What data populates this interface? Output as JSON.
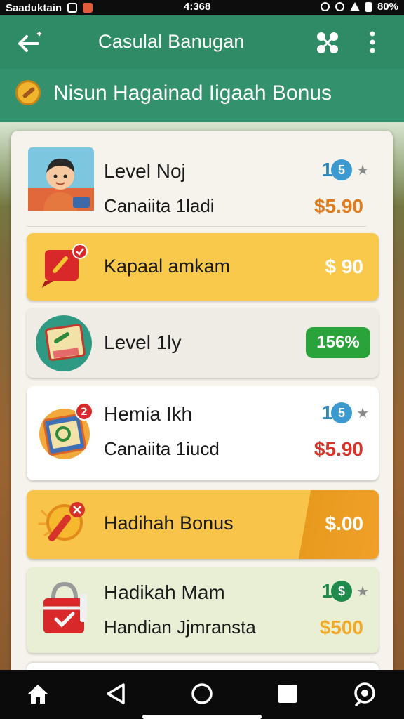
{
  "status_bar": {
    "carrier": "Saaduktain",
    "time": "4:368",
    "battery": "80%"
  },
  "app_bar": {
    "title": "Casulal Banugan",
    "icons": [
      "back-arrow-icon",
      "share-icon",
      "more-vert-icon"
    ]
  },
  "banner": {
    "text": "Nisun Hagainad Iigaah Bonus",
    "icon": "coin-icon"
  },
  "items": [
    {
      "title": "Level Noj",
      "subtitle": "Canaiita 1ladi",
      "price": "$5.90",
      "rating_num": "1",
      "rating_badge": "5",
      "icon": "avatar-boy-icon"
    },
    {
      "title": "Kapaal amkam",
      "price": "$ 90",
      "icon": "ticket-gift-icon"
    },
    {
      "title": "Level 1ly",
      "percent": "156%",
      "icon": "calendar-book-icon"
    },
    {
      "title": "Hemia Ikh",
      "subtitle": "Canaiita 1iucd",
      "price": "$5.90",
      "rating_num": "1",
      "rating_badge": "5",
      "icon": "calendar-badge-icon"
    },
    {
      "title": "Hadihah Bonus",
      "price": "$.00",
      "icon": "trophy-gift-icon"
    },
    {
      "title": "Hadikah Mam",
      "subtitle": "Handian Jjmransta",
      "price": "$500",
      "rating_num": "1",
      "rating_badge": "$",
      "icon": "shopping-bag-icon"
    }
  ],
  "colors": {
    "app_bar": "#2e8b66",
    "banner": "#33916d",
    "price_orange": "#e07b1e",
    "price_red": "#d8332a",
    "price_gold": "#f0a929",
    "percent_green": "#2aa33a",
    "yellow_card": "#f8c94a",
    "gold_card": "#f6b540",
    "light_green_card": "#e8efd5"
  },
  "nav": {
    "icons": [
      "home-icon",
      "back-triangle-icon",
      "home-circle-icon",
      "recents-square-icon",
      "assistant-icon"
    ]
  }
}
